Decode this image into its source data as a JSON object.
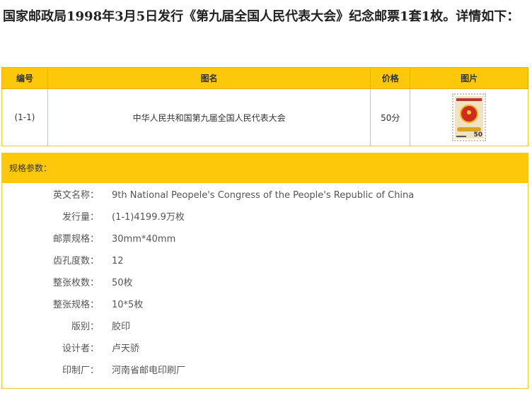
{
  "intro_text": "国家邮政局1998年3月5日发行《第九届全国人民代表大会》纪念邮票1套1枚。详情如下：",
  "table": {
    "headers": {
      "number": "编号",
      "name": "图名",
      "price": "价格",
      "image": "图片"
    },
    "rows": [
      {
        "number": "(1-1)",
        "name": "中华人民共和国第九届全国人民代表大会",
        "price": "50分",
        "stamp_value": "50"
      }
    ]
  },
  "spec": {
    "title": "规格参数：",
    "items": [
      {
        "label": "英文名称：",
        "value": "9th National Peopele's Congress of the People's Republic of China"
      },
      {
        "label": "发行量：",
        "value": "(1-1)4199.9万枚"
      },
      {
        "label": "邮票规格：",
        "value": "30mm*40mm"
      },
      {
        "label": "齿孔度数：",
        "value": "12"
      },
      {
        "label": "整张枚数：",
        "value": "50枚"
      },
      {
        "label": "整张规格：",
        "value": "10*5枚"
      },
      {
        "label": "版别：",
        "value": "胶印"
      },
      {
        "label": "设计者：",
        "value": "卢天骄"
      },
      {
        "label": "印制厂：",
        "value": "河南省邮电印刷厂"
      }
    ]
  },
  "colors": {
    "header_bg": "#fdc80a",
    "border": "#f0c832"
  }
}
